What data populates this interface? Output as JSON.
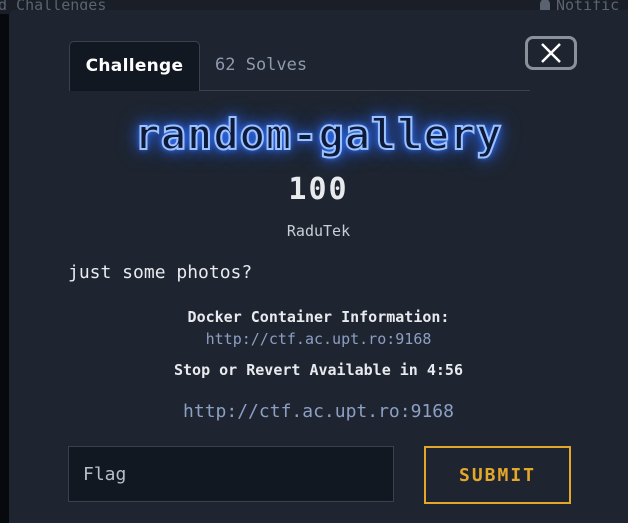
{
  "background": {
    "breadcrumb": "d  Challenges",
    "notifications": "Notific"
  },
  "tabs": [
    {
      "label": "Challenge"
    },
    {
      "label": "62 Solves"
    }
  ],
  "challenge": {
    "name": "random-gallery",
    "points": "100",
    "author": "RaduTek",
    "description": "just some photos?"
  },
  "docker": {
    "title": "Docker Container Information:",
    "link": "http://ctf.ac.upt.ro:9168",
    "status": "Stop or Revert Available in 4:56",
    "connection_link": "http://ctf.ac.upt.ro:9168"
  },
  "form": {
    "flag_placeholder": "Flag",
    "submit_label": "SUBMIT"
  },
  "colors": {
    "modal_bg": "#1e2530",
    "title_glow": "#3a7dff",
    "link": "#8c9fc4",
    "submit_accent": "#e5a72a"
  },
  "icons": {
    "close": "close-icon",
    "bell": "bell-icon"
  }
}
